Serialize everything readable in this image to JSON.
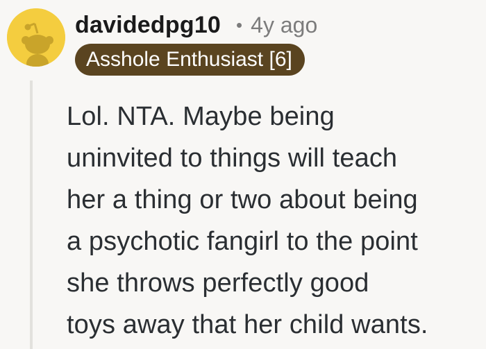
{
  "comment": {
    "avatar_icon": "reddit-snoo-avatar-icon",
    "avatar_color": "#f4cd3f",
    "username": "davidedpg10",
    "separator": "•",
    "age": "4y ago",
    "flair": {
      "text": "Asshole Enthusiast [6]",
      "background": "#5a4420",
      "color": "#ffffff"
    },
    "body_lines": [
      "Lol. NTA. Maybe being",
      "uninvited to things will teach",
      "her a thing or two about being",
      "a psychotic fangirl to the point",
      "she throws perfectly good",
      "toys away that her child wants."
    ]
  }
}
